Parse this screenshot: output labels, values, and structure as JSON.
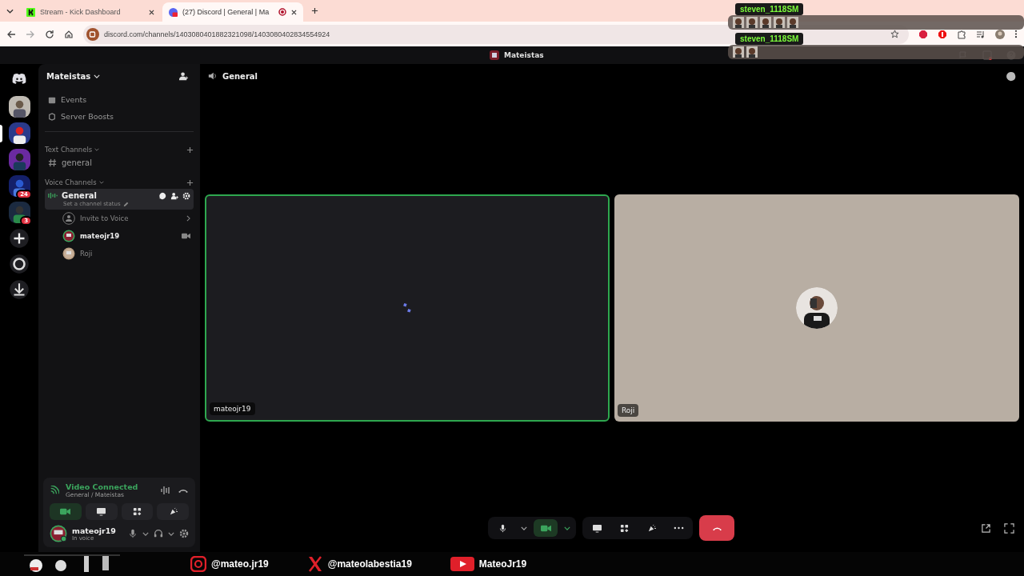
{
  "browser": {
    "tabs": [
      {
        "title": "Stream - Kick Dashboard",
        "kind": "kick",
        "selected": false
      },
      {
        "title": "(27) Discord | General | Ma",
        "kind": "discord",
        "recording": true,
        "selected": true
      }
    ],
    "url": "discord.com/channels/1403080401882321098/1403080402834554924"
  },
  "chat_overlay": [
    {
      "user": "steven_1118SM"
    },
    {
      "user": "steven_1118SM"
    }
  ],
  "title_bar": {
    "title": "Mateistas"
  },
  "servers": [
    {
      "selected": false
    },
    {
      "selected": true
    },
    {
      "selected": false
    },
    {
      "selected": false,
      "badge": "24"
    },
    {
      "selected": false,
      "badge": "3"
    }
  ],
  "sidebar": {
    "server_name": "Mateistas",
    "items": [
      "Events",
      "Server Boosts"
    ],
    "categories": [
      {
        "name": "Text Channels",
        "channels": [
          {
            "name": "general",
            "kind": "text",
            "selected": false
          }
        ]
      },
      {
        "name": "Voice Channels",
        "channels": [
          {
            "name": "General",
            "kind": "voice",
            "selected": true,
            "status": "Set a channel status",
            "children": [
              {
                "kind": "invite",
                "label": "Invite to Voice"
              },
              {
                "kind": "user",
                "label": "mateojr19",
                "active": true,
                "video": true
              },
              {
                "kind": "user",
                "label": "Roji",
                "active": false,
                "video": false
              }
            ]
          }
        ]
      }
    ]
  },
  "voice_panel": {
    "status": "Video Connected",
    "location": "General / Mateistas",
    "camera_on": true
  },
  "user": {
    "name": "mateojr19",
    "status": "In voice"
  },
  "main": {
    "channel": "General",
    "tiles": [
      {
        "name": "mateojr19",
        "kind": "loading",
        "speaking": true
      },
      {
        "name": "Roji",
        "kind": "avatar",
        "speaking": false
      }
    ],
    "camera_on": true
  },
  "stream_bar": {
    "socials": [
      {
        "kind": "instagram",
        "handle": "@mateo.jr19"
      },
      {
        "kind": "x",
        "handle": "@mateolabestia19"
      },
      {
        "kind": "youtube",
        "handle": "MateoJr19"
      }
    ]
  }
}
